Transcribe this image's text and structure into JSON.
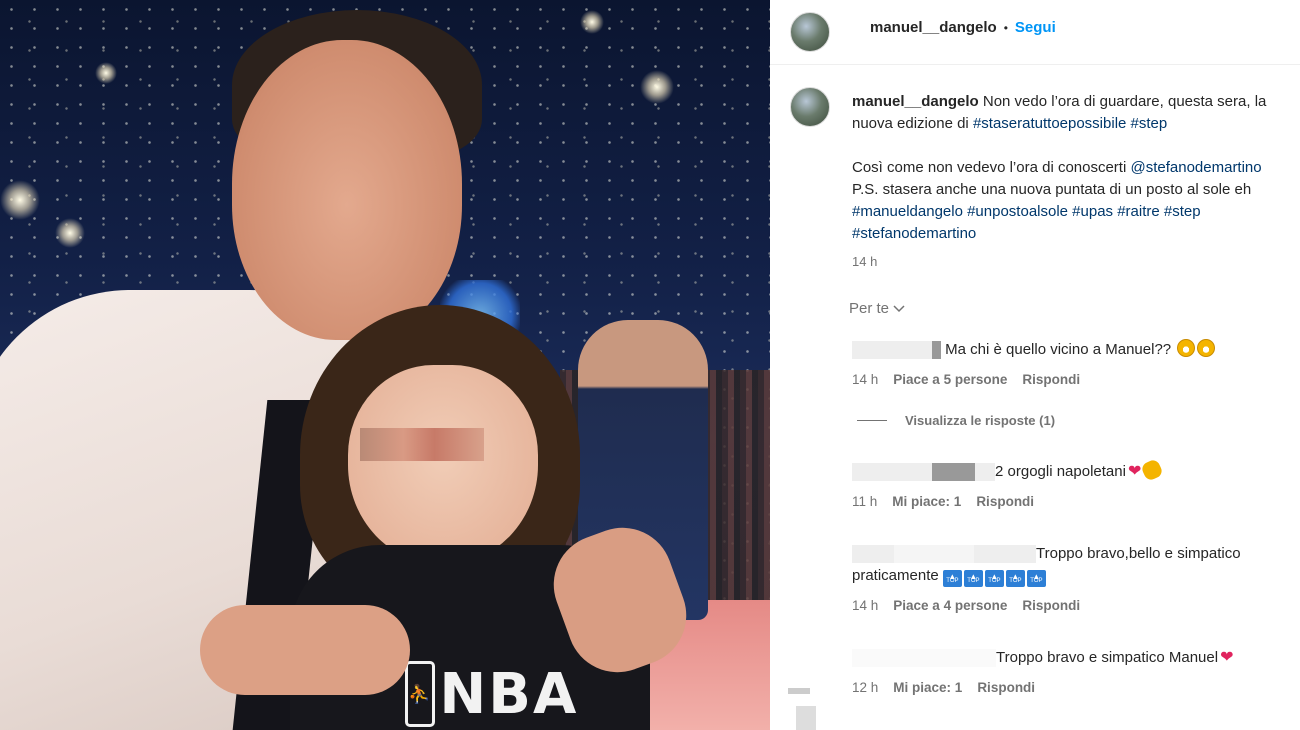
{
  "post": {
    "username": "manuel__dangelo",
    "separator": "•",
    "follow_label": "Segui"
  },
  "photo": {
    "shirt_text": "NBA",
    "shirt_logo_icon": "nba-logo-icon"
  },
  "caption": {
    "username": "manuel__dangelo",
    "line1_text": " Non vedo l’ora di guardare, questa sera, la",
    "line2_text": "nuova edizione di ",
    "line2_tag1": "#staseratuttoepossibile",
    "line2_tag2": "#step",
    "line3_text": "Così come non vedevo l’ora di conoscerti ",
    "line3_mention": "@stefanodemartino",
    "line4_text": "P.S. stasera anche una nuova puntata di un posto al sole eh",
    "line5_tags": "#manueldangelo #unpostoalsole #upas #raitre #step",
    "line6_tags": "#stefanodemartino",
    "time": "14 h"
  },
  "filter": {
    "label": "Per te",
    "icon": "chevron-down-icon"
  },
  "comments": [
    {
      "text": " Ma chi è quello vicino a Manuel?? ",
      "time": "14 h",
      "likes": "Piace a 5 persone",
      "reply": "Rispondi"
    },
    {
      "text": "2 orgogli napoletani",
      "time": "11 h",
      "likes": "Mi piace: 1",
      "reply": "Rispondi"
    },
    {
      "text_line1": "Troppo bravo,bello e simpatico",
      "text_line2": "praticamente ",
      "badge_label": "TOP",
      "time": "14 h",
      "likes": "Piace a 4 persone",
      "reply": "Rispondi"
    },
    {
      "text": "Troppo bravo e simpatico Manuel",
      "time": "12 h",
      "likes": "Mi piace: 1",
      "reply": "Rispondi"
    }
  ],
  "view_replies": "Visualizza le risposte (1)",
  "colors": {
    "link": "#00376b",
    "follow": "#0095f6",
    "muted": "#737373",
    "heart": "#e0245e"
  }
}
